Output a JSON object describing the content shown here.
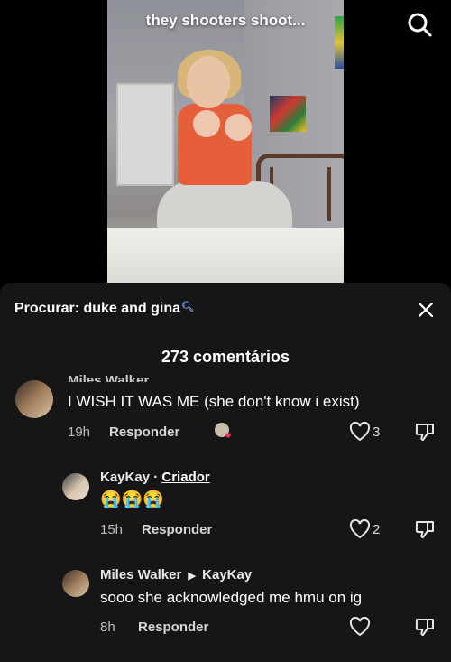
{
  "video": {
    "caption": "they shooters shoot..."
  },
  "sheet": {
    "search_label": "Procurar: duke and gina",
    "comments_count": "273 comentários"
  },
  "comments": [
    {
      "user": "Miles Walker",
      "text": "I WISH IT WAS ME (she don't know i exist)",
      "time": "19h",
      "reply_label": "Responder",
      "likes": "3"
    },
    {
      "user": "KayKay",
      "badge": "Criador",
      "separator": "·",
      "text": "😭😭😭",
      "time": "15h",
      "reply_label": "Responder",
      "likes": "2"
    },
    {
      "user": "Miles Walker",
      "reply_to": "KayKay",
      "text": "sooo she acknowledged me hmu on ig",
      "time": "8h",
      "reply_label": "Responder",
      "likes": ""
    }
  ]
}
